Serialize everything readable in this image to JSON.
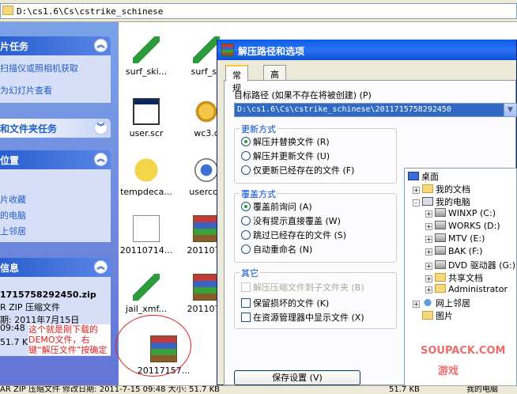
{
  "address": {
    "path": "D:\\cs1.6\\Cs\\cstrike_schinese"
  },
  "task_pane": {
    "picture_tasks": {
      "title": "片任务",
      "items": [
        "扫描仪或照相机获取",
        "为幻灯片查看"
      ]
    },
    "file_folder_tasks": {
      "title": "和文件夹任务"
    },
    "other_places": {
      "title": "位置",
      "items": [
        "片收藏",
        "的电脑",
        "上邻居"
      ]
    },
    "details": {
      "title": "信息",
      "filename": "1715758292450.zip",
      "type": "R ZIP 压缩文件",
      "modified": "期: 2011年7月15日",
      "time": "09:48",
      "size": "51.7 K"
    }
  },
  "files": [
    {
      "name": "surf_ski...",
      "icon": "paintbrush-icon"
    },
    {
      "name": "surf_sk",
      "icon": "paintbrush-icon"
    },
    {
      "name": "user.scr",
      "icon": "screensaver-icon"
    },
    {
      "name": "wc3.c",
      "icon": "gear-icon"
    },
    {
      "name": "tempdeca...",
      "icon": "smiley-icon"
    },
    {
      "name": "usercon",
      "icon": "media-icon"
    },
    {
      "name": "20110714...",
      "icon": "document-icon"
    },
    {
      "name": "2011071",
      "icon": "winrar-icon"
    },
    {
      "name": "jail_xmf...",
      "icon": "paintbrush-icon"
    },
    {
      "name": "2011071",
      "icon": "winrar-icon"
    },
    {
      "name": "20117157...",
      "icon": "winrar-icon"
    }
  ],
  "annotation": {
    "text": "这个就是刚下载的 DEMO文件，右键“解压文件”按确定",
    "color": "#e02020"
  },
  "status_bar": {
    "left": "AR ZIP 压缩文件 修改日期: 2011-7-15 09:48 大小: 51.7 KB",
    "size": "51.7 KB",
    "location": "我的电脑"
  },
  "dialog": {
    "title": "解压路径和选项",
    "tabs": [
      "常规",
      "高级"
    ],
    "target_label": "目标路径 (如果不存在将被创建) (P)",
    "target_path": "D:\\cs1.6\\Cs\\cstrike_schinese\\2011715758292450",
    "update_mode": {
      "title": "更新方式",
      "options": [
        "解压并替换文件 (R)",
        "解压并更新文件 (U)",
        "仅更新已经存在的文件 (F)"
      ],
      "selected": 0
    },
    "overwrite_mode": {
      "title": "覆盖方式",
      "options": [
        "覆盖前询问 (A)",
        "没有提示直接覆盖 (W)",
        "跳过已经存在的文件 (S)",
        "自动重命名 (N)"
      ],
      "selected": 0
    },
    "misc": {
      "title": "其它",
      "options": [
        {
          "label": "解压压缩文件到子文件夹 (B)",
          "disabled": true,
          "checked": false
        },
        {
          "label": "保留损坏的文件 (K)",
          "disabled": false,
          "checked": false
        },
        {
          "label": "在资源管理器中显示文件 (X)",
          "disabled": false,
          "checked": false
        }
      ]
    },
    "save_button": "保存设置 (V)",
    "tree": [
      {
        "label": "桌面",
        "icon": "desktop-icon",
        "level": 0,
        "expander": ""
      },
      {
        "label": "我的文档",
        "icon": "folder-icon",
        "level": 1,
        "expander": "+"
      },
      {
        "label": "我的电脑",
        "icon": "computer-icon",
        "level": 1,
        "expander": "-"
      },
      {
        "label": "WINXP (C:)",
        "icon": "drive-icon",
        "level": 2,
        "expander": "+"
      },
      {
        "label": "WORKS (D:)",
        "icon": "drive-icon",
        "level": 2,
        "expander": "+"
      },
      {
        "label": "MTV (E:)",
        "icon": "drive-icon",
        "level": 2,
        "expander": "+"
      },
      {
        "label": "BAK (F:)",
        "icon": "drive-icon",
        "level": 2,
        "expander": "+"
      },
      {
        "label": "DVD 驱动器 (G:)",
        "icon": "drive-icon",
        "level": 2,
        "expander": "+"
      },
      {
        "label": "共享文档",
        "icon": "folder-icon",
        "level": 2,
        "expander": "+"
      },
      {
        "label": "Administrator",
        "icon": "folder-icon",
        "level": 2,
        "expander": "+"
      },
      {
        "label": "网上邻居",
        "icon": "network-icon",
        "level": 1,
        "expander": "+"
      },
      {
        "label": "图片",
        "icon": "folder-icon",
        "level": 1,
        "expander": ""
      }
    ]
  },
  "watermark": {
    "site": "SOUPACK.COM",
    "caption": "游戏"
  }
}
